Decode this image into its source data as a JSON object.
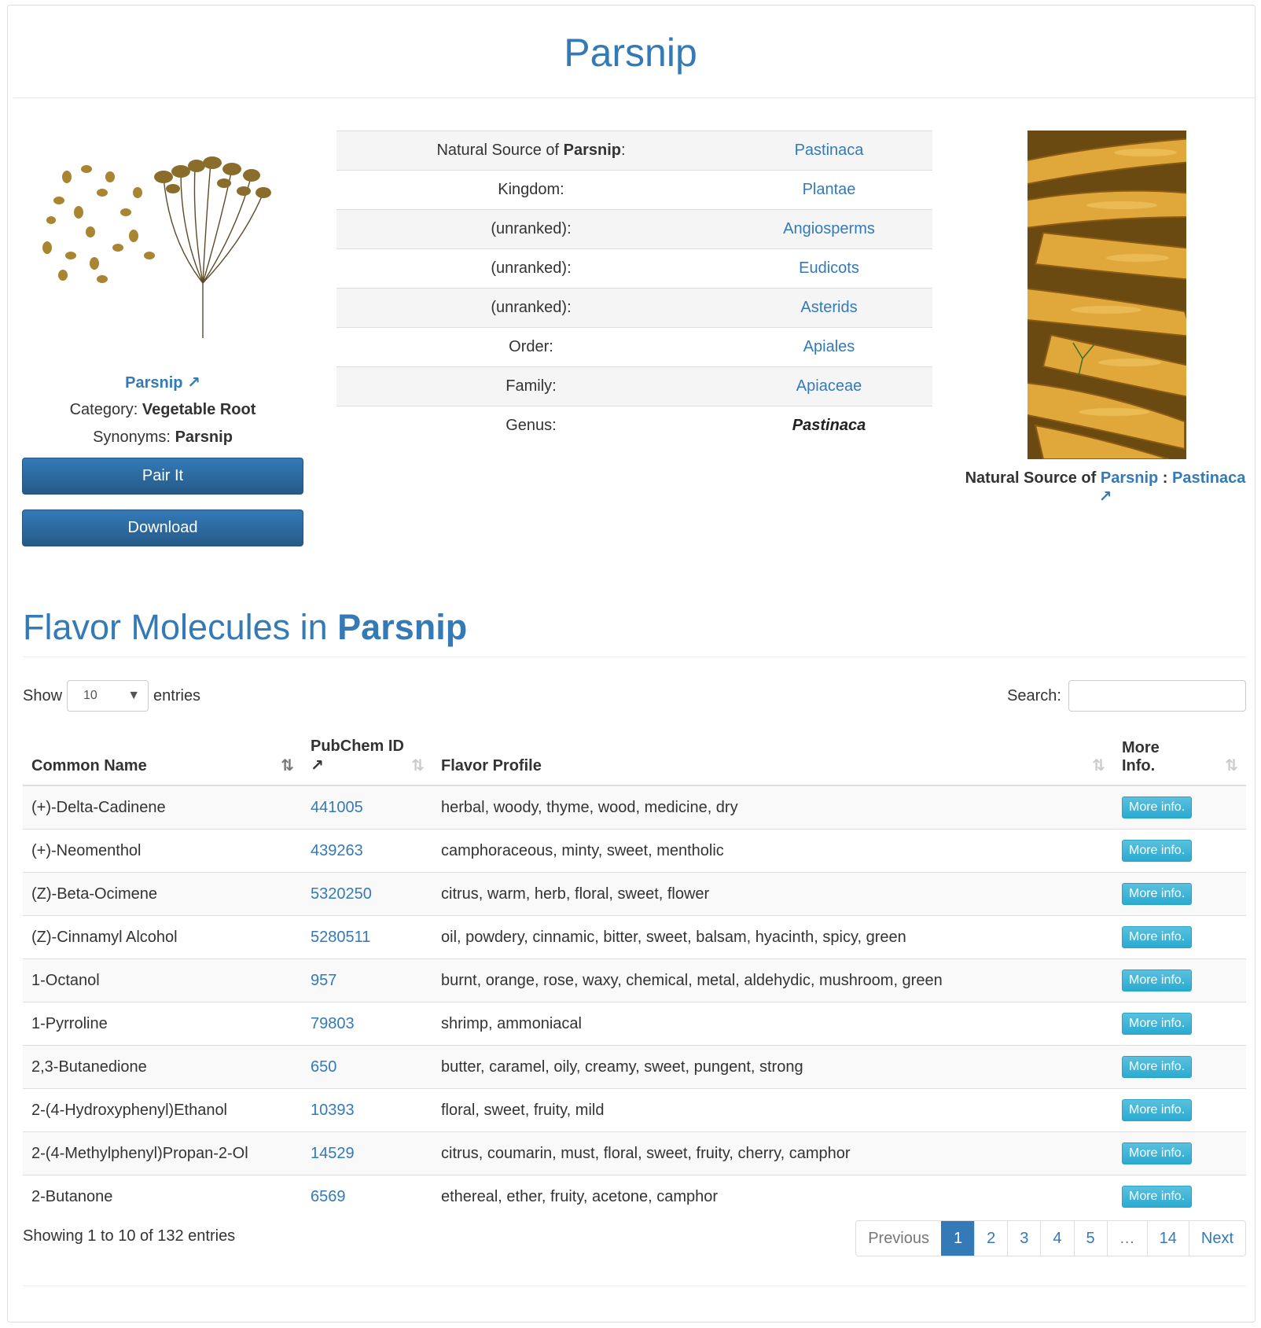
{
  "page": {
    "title": "Parsnip"
  },
  "left": {
    "name_link": "Parsnip",
    "category_label": "Category:",
    "category_value": "Vegetable Root",
    "synonyms_label": "Synonyms:",
    "synonyms_value": "Parsnip",
    "pair_button": "Pair It",
    "download_button": "Download"
  },
  "taxonomy": {
    "source_prefix": "Natural Source of ",
    "source_name": "Parsnip",
    "source_suffix": ":",
    "source_value": "Pastinaca",
    "rows": [
      {
        "label": "Kingdom:",
        "value": "Plantae"
      },
      {
        "label": "(unranked):",
        "value": "Angiosperms"
      },
      {
        "label": "(unranked):",
        "value": "Eudicots"
      },
      {
        "label": "(unranked):",
        "value": "Asterids"
      },
      {
        "label": "Order:",
        "value": "Apiales"
      },
      {
        "label": "Family:",
        "value": "Apiaceae"
      }
    ],
    "genus_label": "Genus:",
    "genus_value": "Pastinaca"
  },
  "right_caption": {
    "prefix": "Natural Source of ",
    "name": "Parsnip",
    "sep": " : ",
    "source": "Pastinaca"
  },
  "flavor": {
    "title_prefix": "Flavor Molecules in ",
    "title_name": "Parsnip",
    "show_label": "Show",
    "entries_select": "10",
    "entries_label": "entries",
    "search_label": "Search:",
    "search_value": "",
    "columns": {
      "common_name": "Common Name",
      "pubchem_line1": "PubChem ID",
      "flavor_profile": "Flavor Profile",
      "more_info_line1": "More",
      "more_info_line2": "Info."
    },
    "rows": [
      {
        "name": "(+)-Delta-Cadinene",
        "pubchem": "441005",
        "profile": "herbal, woody, thyme, wood, medicine, dry",
        "button": "More info."
      },
      {
        "name": "(+)-Neomenthol",
        "pubchem": "439263",
        "profile": "camphoraceous, minty, sweet, mentholic",
        "button": "More info."
      },
      {
        "name": "(Z)-Beta-Ocimene",
        "pubchem": "5320250",
        "profile": "citrus, warm, herb, floral, sweet, flower",
        "button": "More info."
      },
      {
        "name": "(Z)-Cinnamyl Alcohol",
        "pubchem": "5280511",
        "profile": "oil, powdery, cinnamic, bitter, sweet, balsam, hyacinth, spicy, green",
        "button": "More info."
      },
      {
        "name": "1-Octanol",
        "pubchem": "957",
        "profile": "burnt, orange, rose, waxy, chemical, metal, aldehydic, mushroom, green",
        "button": "More info."
      },
      {
        "name": "1-Pyrroline",
        "pubchem": "79803",
        "profile": "shrimp, ammoniacal",
        "button": "More info."
      },
      {
        "name": "2,3-Butanedione",
        "pubchem": "650",
        "profile": "butter, caramel, oily, creamy, sweet, pungent, strong",
        "button": "More info."
      },
      {
        "name": "2-(4-Hydroxyphenyl)Ethanol",
        "pubchem": "10393",
        "profile": "floral, sweet, fruity, mild",
        "button": "More info."
      },
      {
        "name": "2-(4-Methylphenyl)Propan-2-Ol",
        "pubchem": "14529",
        "profile": "citrus, coumarin, must, floral, sweet, fruity, cherry, camphor",
        "button": "More info."
      },
      {
        "name": "2-Butanone",
        "pubchem": "6569",
        "profile": "ethereal, ether, fruity, acetone, camphor",
        "button": "More info."
      }
    ],
    "info": "Showing 1 to 10 of 132 entries",
    "pagination": {
      "previous": "Previous",
      "pages": [
        "1",
        "2",
        "3",
        "4",
        "5",
        "…",
        "14"
      ],
      "next": "Next"
    }
  }
}
